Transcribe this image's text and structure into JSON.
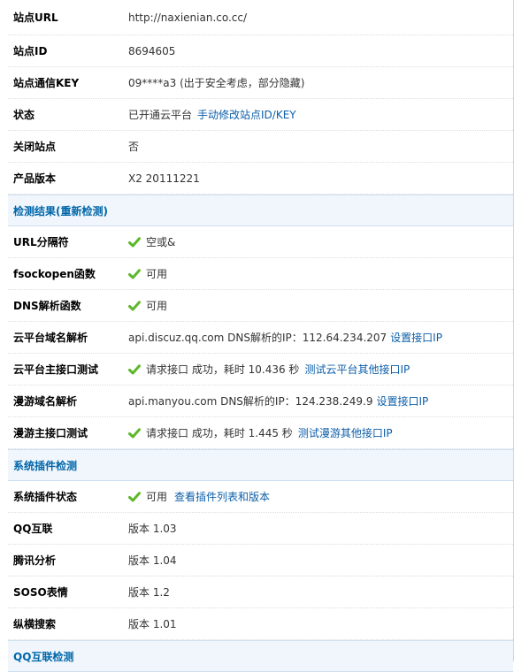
{
  "site_info": [
    {
      "label": "站点URL",
      "value": "http://naxienian.co.cc/"
    },
    {
      "label": "站点ID",
      "value": "8694605"
    },
    {
      "label": "站点通信KEY",
      "value": "09****a3 (出于安全考虑，部分隐藏)"
    },
    {
      "label": "状态",
      "value": "已开通云平台",
      "link": "手动修改站点ID/KEY"
    },
    {
      "label": "关闭站点",
      "value": "否"
    },
    {
      "label": "产品版本",
      "value": "X2 20111221"
    }
  ],
  "detection": {
    "title": "检测结果(重新检测)",
    "rows": [
      {
        "label": "URL分隔符",
        "value": "空或&"
      },
      {
        "label": "fsockopen函数",
        "value": "可用"
      },
      {
        "label": "DNS解析函数",
        "value": "可用"
      },
      {
        "label": "云平台域名解析",
        "value": "api.discuz.qq.com DNS解析的IP：112.64.234.207",
        "link": "设置接口IP"
      },
      {
        "label": "云平台主接口测试",
        "value": "请求接口 成功，耗时 10.436 秒",
        "link": "测试云平台其他接口IP"
      },
      {
        "label": "漫游域名解析",
        "value": "api.manyou.com DNS解析的IP：124.238.249.9",
        "link": "设置接口IP"
      },
      {
        "label": "漫游主接口测试",
        "value": "请求接口 成功，耗时 1.445 秒",
        "link": "测试漫游其他接口IP"
      }
    ]
  },
  "plugins": {
    "title": "系统插件检测",
    "rows": [
      {
        "label": "系统插件状态",
        "value": "可用",
        "link": "查看插件列表和版本"
      },
      {
        "label": "QQ互联",
        "value": "版本 1.03"
      },
      {
        "label": "腾讯分析",
        "value": "版本 1.04"
      },
      {
        "label": "SOSO表情",
        "value": "版本 1.2"
      },
      {
        "label": "纵横搜索",
        "value": "版本 1.01"
      }
    ]
  },
  "qq_connect": {
    "title": "QQ互联检测"
  },
  "colors": {
    "check": "#5cb82a",
    "link": "#0c5ea8",
    "section_title": "#0066aa"
  }
}
